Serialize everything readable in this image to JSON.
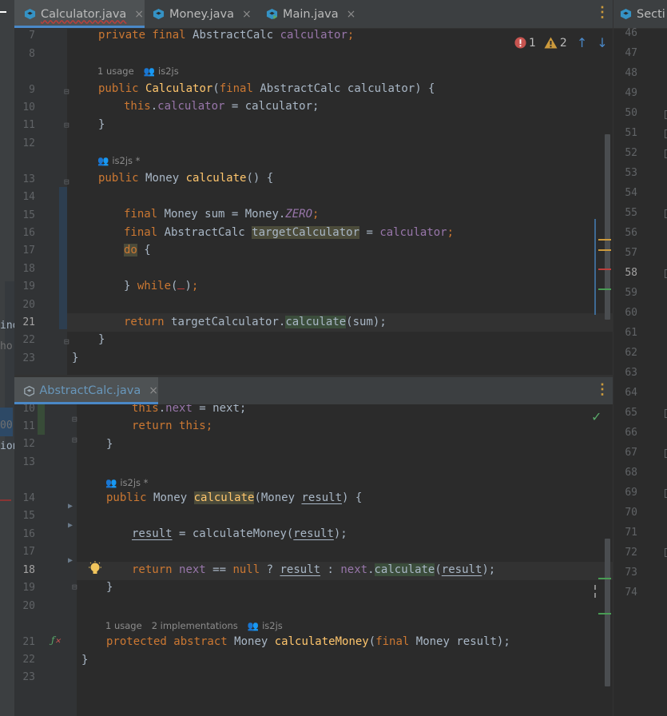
{
  "top_tabs": {
    "tabs": [
      {
        "label": "Calculator.java",
        "close": "×"
      },
      {
        "label": "Money.java",
        "close": "×"
      },
      {
        "label": "Main.java",
        "close": "×"
      }
    ],
    "more": "⋮"
  },
  "right_tab": {
    "label": "Secti"
  },
  "inspection": {
    "errors": "1",
    "warnings": "2"
  },
  "bottom_tabs": {
    "tabs": [
      {
        "label": "AbstractCalc.java",
        "close": "×"
      }
    ],
    "more": "⋮"
  },
  "left_strip_fragments": [
    "ino",
    "ho",
    "00",
    "ion"
  ],
  "top_editor": {
    "line_numbers": [
      "7",
      "8",
      "9",
      "10",
      "11",
      "12",
      "13",
      "14",
      "15",
      "16",
      "17",
      "18",
      "19",
      "20",
      "21",
      "22",
      "23"
    ],
    "hints": {
      "usage": "1 usage",
      "author": "is2js",
      "author_mod": "is2js *"
    },
    "code": {
      "l7_a": "private final ",
      "l7_b": "AbstractCalc ",
      "l7_c": "calculator",
      "l7_d": ";",
      "l9_a": "public ",
      "l9_b": "Calculator",
      "l9_c": "(",
      "l9_d": "final ",
      "l9_e": "AbstractCalc calculator) {",
      "l10_a": "this",
      "l10_b": ".",
      "l10_c": "calculator",
      "l10_d": " = calculator;",
      "l11": "}",
      "l13_a": "public ",
      "l13_b": "Money ",
      "l13_c": "calculate",
      "l13_d": "() {",
      "l15_a": "final ",
      "l15_b": "Money sum = Money.",
      "l15_c": "ZERO",
      "l15_d": ";",
      "l16_a": "final ",
      "l16_b": "AbstractCalc ",
      "l16_c": "targetCalculator",
      "l16_d": " = ",
      "l16_e": "calculator",
      "l16_f": ";",
      "l17_a": "do",
      "l17_b": " {",
      "l19_a": "} ",
      "l19_b": "while",
      "l19_c": "(",
      "l19_d": ")",
      "l19_e": ";",
      "l21_a": "return ",
      "l21_b": "targetCalculator.",
      "l21_c": "calculate",
      "l21_d": "(sum);",
      "l22": "}",
      "l23": "}"
    }
  },
  "right_editor": {
    "line_numbers": [
      "46",
      "47",
      "48",
      "49",
      "50",
      "51",
      "52",
      "53",
      "54",
      "55",
      "56",
      "57",
      "58",
      "59",
      "60",
      "61",
      "62",
      "63",
      "64",
      "65",
      "66",
      "67",
      "68",
      "69",
      "70",
      "71",
      "72",
      "73",
      "74"
    ],
    "current": "58"
  },
  "bottom_editor": {
    "line_numbers": [
      "10",
      "11",
      "12",
      "13",
      "14",
      "15",
      "16",
      "17",
      "18",
      "19",
      "20",
      "21",
      "22",
      "23"
    ],
    "hints": {
      "author_mod": "is2js *",
      "usages": "1 usage",
      "impls": "2 implementations",
      "author": "is2js"
    },
    "code": {
      "l10_a": "this",
      "l10_b": ".",
      "l10_c": "next",
      "l10_d": " = next;",
      "l11_a": "return ",
      "l11_b": "this",
      "l11_c": ";",
      "l12": "}",
      "l14_a": "public ",
      "l14_b": "Money ",
      "l14_c": "calculate",
      "l14_d": "(Money ",
      "l14_e": "result",
      "l14_f": ") {",
      "l16_a": "result",
      "l16_b": " = calculateMoney(",
      "l16_c": "result",
      "l16_d": ");",
      "l18_a": "return ",
      "l18_b": "next",
      "l18_c": " == ",
      "l18_d": "null",
      "l18_e": " ? ",
      "l18_f": "result",
      "l18_g": " : ",
      "l18_h": "next",
      "l18_i": ".",
      "l18_j": "calculate",
      "l18_k": "(",
      "l18_l": "result",
      "l18_m": ");",
      "l19": "}",
      "l21_a": "protected abstract ",
      "l21_b": "Money ",
      "l21_c": "calculateMoney",
      "l21_d": "(",
      "l21_e": "final ",
      "l21_f": "Money result);",
      "l22": "}"
    }
  },
  "colors": {
    "background": "#2b2b2b",
    "keyword": "#cc7832",
    "field": "#9876aa",
    "method": "#ffc66d",
    "text": "#a9b7c6",
    "accent": "#4a88c7"
  }
}
